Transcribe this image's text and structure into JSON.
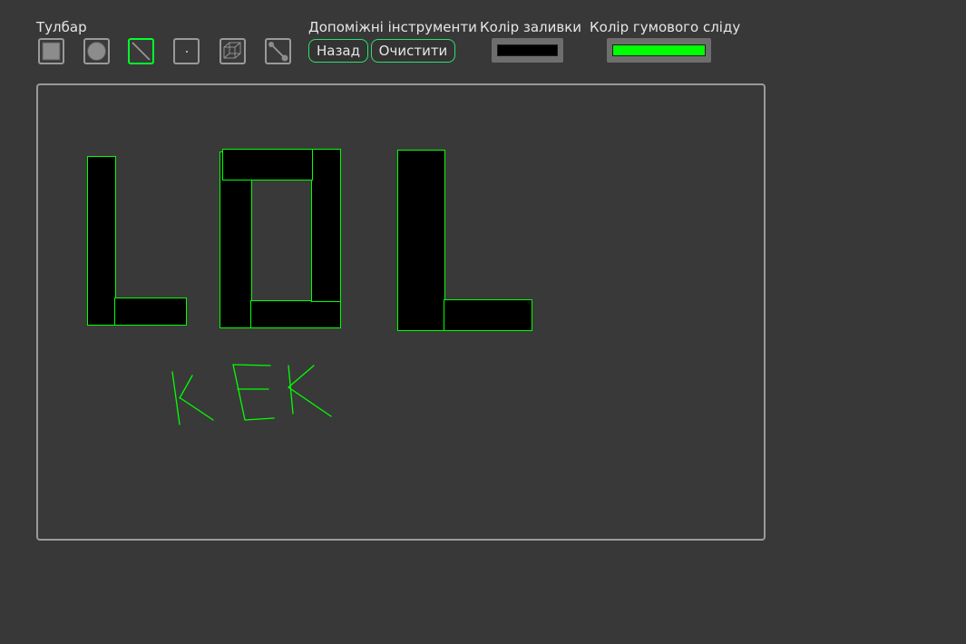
{
  "toolbar": {
    "label": "Тулбар",
    "active_tool": "line",
    "tools": [
      "rectangle",
      "ellipse",
      "line",
      "point",
      "cube",
      "segment-with-endpoints"
    ]
  },
  "helpers": {
    "label": "Допоміжні інструменти",
    "back_label": "Назад",
    "clear_label": "Очистити"
  },
  "fill_color": {
    "label": "Колір заливки",
    "value": "#000000"
  },
  "rubber_color": {
    "label": "Колір гумового сліду",
    "value": "#00ff00"
  },
  "canvas": {
    "stroke_color": "#00ff00",
    "fill_color": "#000000"
  }
}
